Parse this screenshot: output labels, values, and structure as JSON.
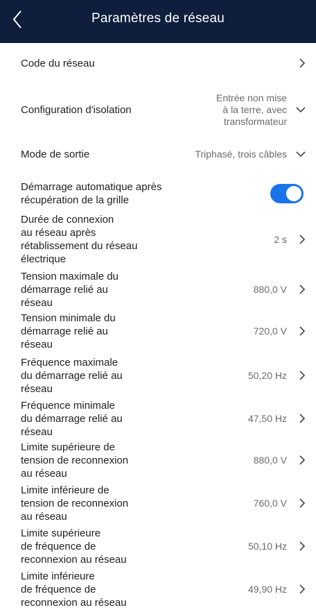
{
  "header": {
    "title": "Paramètres de réseau",
    "back_icon": "chevron-left-icon"
  },
  "rows": [
    {
      "label": "Code du réseau",
      "value": "",
      "control": "chevron-right"
    },
    {
      "label": "Configuration d'isolation",
      "value": "Entrée non mise\nà la terre, avec\ntransformateur",
      "control": "chevron-down"
    },
    {
      "label": "Mode de sortie",
      "value": "Triphasé, trois câbles",
      "control": "chevron-down"
    },
    {
      "label": "Démarrage automatique après\nrécupération de la grille",
      "value": "",
      "control": "toggle",
      "toggle_on": true
    },
    {
      "label": "Durée de connexion\nau réseau après\nrétablissement du réseau\nélectrique",
      "value": "2 s",
      "control": "chevron-right"
    },
    {
      "label": "Tension maximale du\ndémarrage relié au\nréseau",
      "value": "880,0 V",
      "control": "chevron-right"
    },
    {
      "label": "Tension minimale du\ndémarrage relié au\nréseau",
      "value": "720,0 V",
      "control": "chevron-right"
    },
    {
      "label": "Fréquence maximale\ndu démarrage relié au\nréseau",
      "value": "50,20 Hz",
      "control": "chevron-right"
    },
    {
      "label": "Fréquence minimale\ndu démarrage relié au\nréseau",
      "value": "47,50 Hz",
      "control": "chevron-right"
    },
    {
      "label": "Limite supérieure de\ntension de reconnexion\nau réseau",
      "value": "880,0 V",
      "control": "chevron-right"
    },
    {
      "label": "Limite inférieure de\ntension de reconnexion\nau réseau",
      "value": "760,0 V",
      "control": "chevron-right"
    },
    {
      "label": "Limite supérieure\nde fréquence de\nreconnexion au réseau",
      "value": "50,10 Hz",
      "control": "chevron-right"
    },
    {
      "label": "Limite inférieure\nde fréquence de\nreconnexion au réseau",
      "value": "49,90 Hz",
      "control": "chevron-right"
    }
  ],
  "colors": {
    "header_bg": "#0e1e3c",
    "toggle_on": "#1a73e8"
  }
}
